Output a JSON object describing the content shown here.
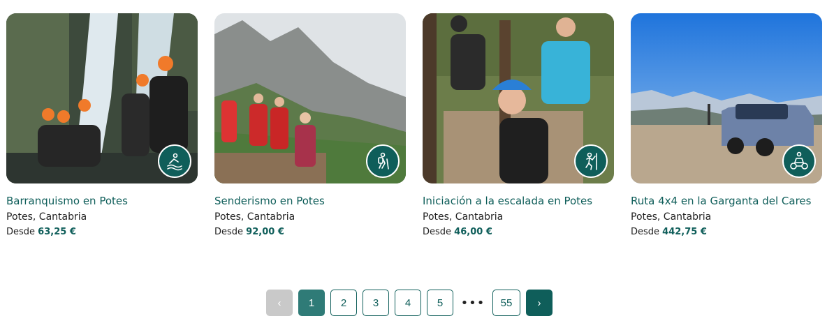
{
  "activities": [
    {
      "title": "Barranquismo en Potes",
      "location": "Potes, Cantabria",
      "price_prefix": "Desde",
      "price": "63,25 €",
      "icon": "canyoning-icon"
    },
    {
      "title": "Senderismo en Potes",
      "location": "Potes, Cantabria",
      "price_prefix": "Desde",
      "price": "92,00 €",
      "icon": "hiking-icon"
    },
    {
      "title": "Iniciación a la escalada en Potes",
      "location": "Potes, Cantabria",
      "price_prefix": "Desde",
      "price": "46,00 €",
      "icon": "climbing-icon"
    },
    {
      "title": "Ruta 4x4 en la Garganta del Cares",
      "location": "Potes, Cantabria",
      "price_prefix": "Desde",
      "price": "442,75 €",
      "icon": "quad-4x4-icon"
    }
  ],
  "pagination": {
    "prev": "‹",
    "pages": [
      "1",
      "2",
      "3",
      "4",
      "5"
    ],
    "current": "1",
    "ellipsis": "•••",
    "last": "55",
    "next": "›"
  },
  "colors": {
    "brand": "#0f5e5a",
    "active_page": "#2f7b77",
    "disabled": "#c9c9c9"
  }
}
